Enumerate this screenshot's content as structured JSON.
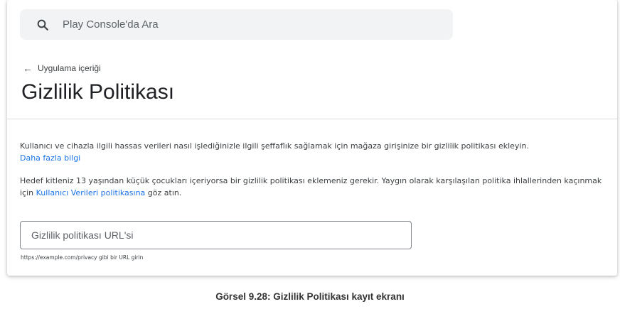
{
  "search": {
    "placeholder": "Play Console'da Ara",
    "icon": "search-icon"
  },
  "breadcrumb": {
    "arrow": "←",
    "label": "Uygulama içeriği"
  },
  "page": {
    "title": "Gizlilik Politikası"
  },
  "description": {
    "paragraph1": "Kullanıcı ve cihazla ilgili hassas verileri nasıl işlediğinizle ilgili şeffaflık sağlamak için mağaza girişinize bir gizlilik politikası ekleyin.",
    "learn_more": "Daha fazla bilgi",
    "paragraph2_before": "Hedef kitleniz 13 yaşından küçük çocukları içeriyorsa bir gizlilik politikası eklemeniz gerekir. Yaygın olarak karşılaşılan politika ihlallerinden kaçınmak için ",
    "paragraph2_link": "Kullanıcı Verileri politikasına",
    "paragraph2_after": " göz atın."
  },
  "url_field": {
    "placeholder": "Gizlilik politikası URL'si",
    "value": "",
    "helper": "https://example.com/privacy gibi bir URL girin"
  },
  "caption": "Görsel 9.28: Gizlilik Politikası kayıt ekranı",
  "colors": {
    "link": "#1a73e8",
    "search_bg": "#f1f3f4",
    "text_primary": "#202124",
    "text_secondary": "#3c4043",
    "divider": "#dadce0"
  }
}
